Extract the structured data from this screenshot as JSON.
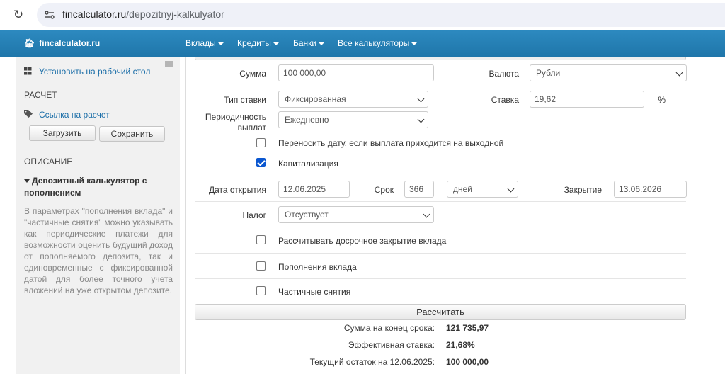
{
  "browser": {
    "url_host": "fincalculator.ru",
    "url_path": "/depozitnyj-kalkulyator"
  },
  "navbar": {
    "brand": "fincalculator.ru",
    "items": [
      {
        "label": "Вклады"
      },
      {
        "label": "Кредиты"
      },
      {
        "label": "Банки"
      },
      {
        "label": "Все калькуляторы"
      }
    ]
  },
  "sidebar": {
    "install_link": "Установить на рабочий стол",
    "calc_heading": "РАСЧЕТ",
    "share_link": "Ссылка на расчет",
    "load_button": "Загрузить",
    "save_button": "Сохранить",
    "desc_heading": "ОПИСАНИЕ",
    "desc_title": "Депозитный калькулятор с пополнением",
    "desc_text": "В параметрах \"пополнения вклада\" и \"частичные снятия\" можно указывать как периодические платежи для возможности оценить будущий доход от пополняемого депозита, так и единовременные с фиксированной датой для более точного учета вложений на уже открытом депозите."
  },
  "form": {
    "sum_label": "Сумма",
    "sum_value": "100 000,00",
    "currency_label": "Валюта",
    "currency_value": "Рубли",
    "rate_type_label": "Тип ставки",
    "rate_type_value": "Фиксированная",
    "rate_label": "Ставка",
    "rate_value": "19,62",
    "rate_unit": "%",
    "period_label_1": "Периодичность",
    "period_label_2": "выплат",
    "period_value": "Ежедневно",
    "move_date_label": "Переносить дату, если выплата приходится на выходной",
    "move_date_checked": false,
    "capitalization_label": "Капитализация",
    "capitalization_checked": true,
    "open_date_label": "Дата открытия",
    "open_date_value": "12.06.2025",
    "term_label": "Срок",
    "term_value": "366",
    "term_unit_value": "дней",
    "close_label": "Закрытие",
    "close_value": "13.06.2026",
    "tax_label": "Налог",
    "tax_value": "Отсуствует",
    "early_close_label": "Рассчитывать досрочное закрытие вклада",
    "early_close_checked": false,
    "deposits_label": "Пополнения вклада",
    "deposits_checked": false,
    "withdrawals_label": "Частичные снятия",
    "withdrawals_checked": false,
    "calculate_button": "Рассчитать"
  },
  "results": {
    "final_sum_label": "Сумма на конец срока:",
    "final_sum_value": "121 735,97",
    "effective_rate_label": "Эффективная ставка:",
    "effective_rate_value": "21,68%",
    "current_balance_label": "Текущий остаток на 12.06.2025:",
    "current_balance_value": "100 000,00"
  }
}
